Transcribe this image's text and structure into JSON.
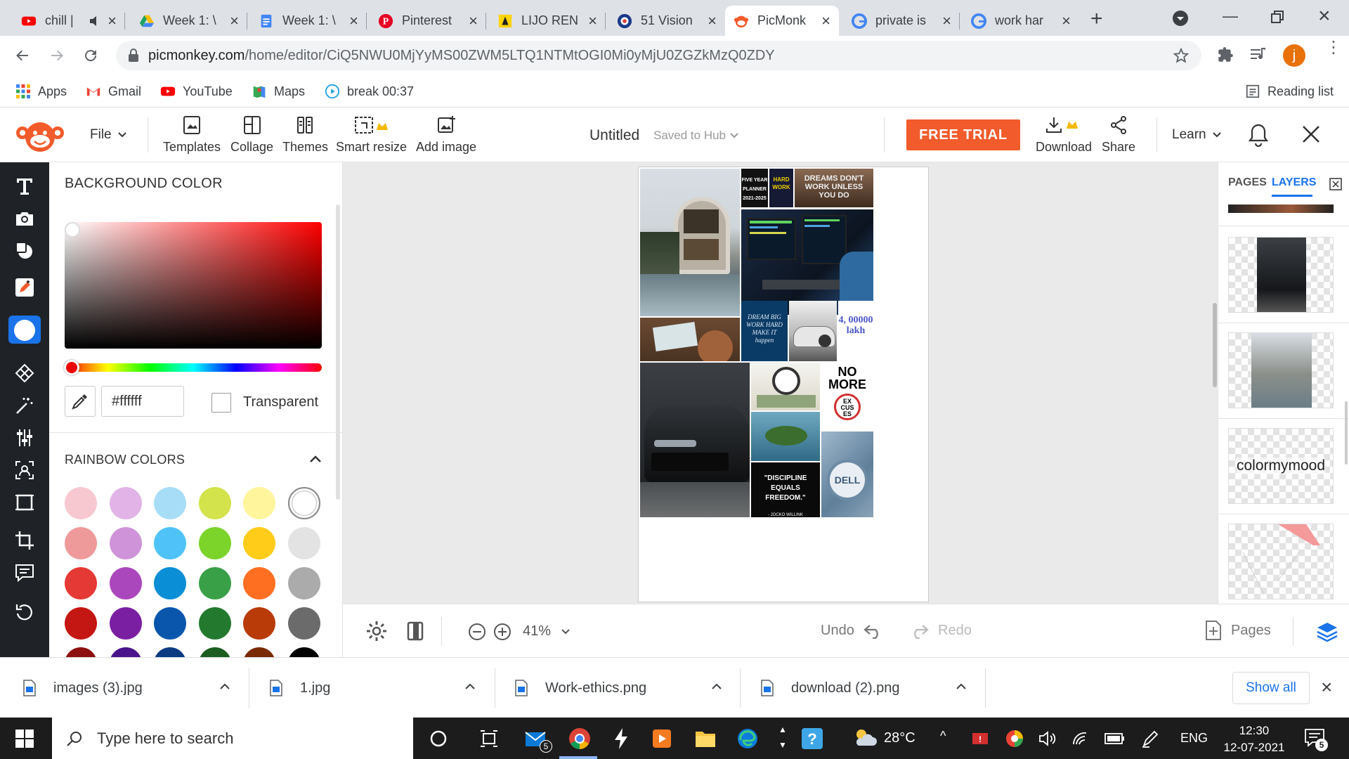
{
  "browser": {
    "tabs": [
      {
        "title": "chill |",
        "icon": "youtube-icon"
      },
      {
        "title": "Week 1: \\",
        "icon": "google-drive-icon"
      },
      {
        "title": "Week 1: \\",
        "icon": "google-docs-icon"
      },
      {
        "title": "Pinterest",
        "icon": "pinterest-icon"
      },
      {
        "title": "LIJO REN",
        "icon": "site-icon"
      },
      {
        "title": "51 Vision",
        "icon": "site-icon"
      },
      {
        "title": "PicMonk",
        "icon": "picmonkey-icon"
      },
      {
        "title": "private is",
        "icon": "google-icon"
      },
      {
        "title": "work har",
        "icon": "google-icon"
      }
    ],
    "url_host": "picmonkey.com",
    "url_path": "/home/editor/CiQ5NWU0MjYyMS00ZWM5LTQ1NTMtOGI0Mi0yMjU0ZGZkMzQ0ZDY",
    "profile_initial": "j",
    "bookmarks": [
      "Apps",
      "Gmail",
      "YouTube",
      "Maps",
      "break 00:37"
    ],
    "reading_list": "Reading list"
  },
  "editor": {
    "file_menu": "File",
    "tools": [
      "Templates",
      "Collage",
      "Themes",
      "Smart resize",
      "Add image"
    ],
    "doc_title": "Untitled",
    "save_status": "Saved to Hub",
    "free_trial": "FREE TRIAL",
    "download": "Download",
    "share": "Share",
    "learn": "Learn"
  },
  "left_panel": {
    "title": "BACKGROUND COLOR",
    "hex_value": "#ffffff",
    "transparent_label": "Transparent",
    "rainbow_title": "RAINBOW COLORS",
    "rainbow_swatches": [
      [
        "#f8c8d0",
        "#e1b3e6",
        "#a7ddf7",
        "#d2e34b",
        "#fff59d",
        "#ffffff"
      ],
      [
        "#ef9a9a",
        "#ce93d8",
        "#4fc3f7",
        "#7cd32a",
        "#ffcc1a",
        "#e3e3e3"
      ],
      [
        "#e53935",
        "#ab47bc",
        "#0a8ed6",
        "#3aa048",
        "#ff6f22",
        "#ababab"
      ],
      [
        "#c41612",
        "#7b1fa2",
        "#0a56ad",
        "#237a2f",
        "#b83b08",
        "#6b6b6b"
      ],
      [
        "#8e0f0f",
        "#4a148c",
        "#0d3b82",
        "#1b5e20",
        "#7a2b04",
        "#000000"
      ]
    ]
  },
  "collage": {
    "texts": {
      "planner": "FIVE YEAR PLANNER 2021-2025",
      "hard_work": "HARD WORK",
      "dreams": "DREAMS DON'T WORK UNLESS YOU DO",
      "dream_big": "DREAM BIG WORK HARD MAKE IT happen",
      "lakh": "4, 00000 lakh",
      "no_more": "NO MORE",
      "excuses": "EX CUS ES",
      "discipline": "\"DISCIPLINE EQUALS FREEDOM.\"",
      "author": "- JOCKO WILLINK",
      "brand": "DELL"
    }
  },
  "bottom_bar": {
    "zoom": "41%",
    "undo": "Undo",
    "redo": "Redo",
    "pages": "Pages"
  },
  "right_panel": {
    "tab_pages": "PAGES",
    "tab_layers": "LAYERS",
    "layer_text": "colormymood"
  },
  "downloads": [
    {
      "name": "images (3).jpg"
    },
    {
      "name": "1.jpg"
    },
    {
      "name": "Work-ethics.png"
    },
    {
      "name": "download (2).png"
    }
  ],
  "downloads_show_all": "Show all",
  "taskbar": {
    "search_placeholder": "Type here to search",
    "temperature": "28°C",
    "language": "ENG",
    "time": "12:30",
    "date": "12-07-2021",
    "notifications": "5",
    "mail_badge": "5"
  }
}
